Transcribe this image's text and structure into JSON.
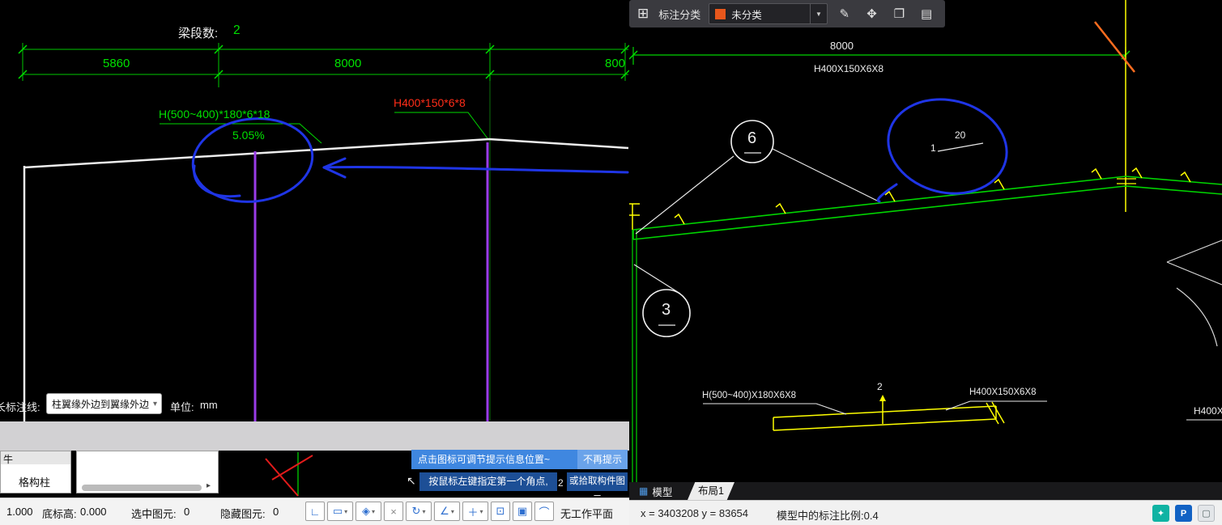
{
  "left_panel": {
    "header": {
      "beam_segments_label": "梁段数:",
      "beam_segments_value": "2"
    },
    "dimensions": {
      "d1": "5860",
      "d2": "8000",
      "d3": "800"
    },
    "annotations": {
      "beam_spec_1": "H(500~400)*180*6*18",
      "beam_spec_2": "H400*150*6*8",
      "slope": "5.05%"
    },
    "controls": {
      "dim_line_label": "长标注线:",
      "dim_line_value": "柱翼缘外边到翼缘外边",
      "caret": "▾",
      "unit_label": "单位:",
      "unit_value": "mm"
    },
    "component_list": {
      "item_partial": "牛",
      "item_selected": "格构柱",
      "scroll_arrow": "▸"
    },
    "tooltip": {
      "hint": "点击图标可调节提示信息位置~",
      "dismiss": "不再提示",
      "cursor_icon": "↖",
      "prompt_1": "按鼠标左键指定第一个角点,",
      "stray_digit": "2",
      "prompt_2": "或拾取构件图元"
    },
    "statusbar": {
      "scale": "1.000",
      "base_elev_label": "底标高:",
      "base_elev_value": "0.000",
      "selected_label": "选中图元:",
      "selected_value": "0",
      "hidden_label": "隐藏图元:",
      "hidden_value": "0",
      "workplane": "无工作平面",
      "caret": "▾",
      "icons": [
        {
          "glyph": "∟"
        },
        {
          "glyph": "▭"
        },
        {
          "glyph": "◈"
        },
        {
          "glyph": "×"
        },
        {
          "glyph": "↻"
        },
        {
          "glyph": "∠"
        },
        {
          "glyph": "＋"
        },
        {
          "glyph": "⊡"
        },
        {
          "glyph": "▣"
        },
        {
          "glyph": "⌒"
        }
      ]
    }
  },
  "right_panel": {
    "dimension_top": "8000",
    "beam_spec_top": "H400X150X6X8",
    "callout_6": "6",
    "callout_3": "3",
    "slope": {
      "rise": "1",
      "run": "20"
    },
    "detail": {
      "beam_spec_left": "H(500~400)X180X6X8",
      "count": "2",
      "beam_spec_right": "H400X150X6X8",
      "beam_spec_edge": "H400X"
    },
    "toolbar": {
      "grid_icon": "⊞",
      "category_label": "标注分类",
      "category_value": "未分类",
      "caret": "▼",
      "edit_icon": "✎",
      "move_icon": "✥",
      "copy_icon": "❐",
      "paste_icon": "▤"
    },
    "tabs": {
      "model_icon": "▦",
      "model": "模型",
      "layout": "布局1"
    },
    "statusbar": {
      "coords": "x = 3403208  y = 83654",
      "scale_text": "模型中的标注比例:0.4",
      "icons": {
        "t1": "✦",
        "t2": "P",
        "t3": "▢"
      }
    }
  }
}
